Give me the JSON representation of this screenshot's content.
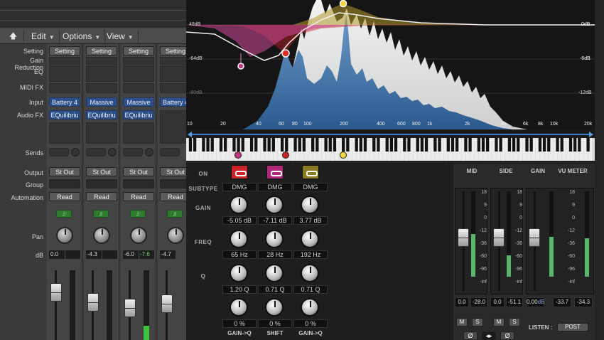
{
  "menu": {
    "edit": "Edit",
    "options": "Options",
    "view": "View"
  },
  "rows": {
    "setting": "Setting",
    "gain_reduction": "Gain Reduction",
    "eq": "EQ",
    "midi_fx": "MIDI FX",
    "input": "Input",
    "audio_fx": "Audio FX",
    "sends": "Sends",
    "output": "Output",
    "group": "Group",
    "automation": "Automation",
    "pan": "Pan",
    "db": "dB"
  },
  "channels": [
    {
      "setting": "Setting",
      "input": "Battery 4",
      "fx": "EQuilibriu",
      "output": "St Out",
      "auto": "Read",
      "db": "0.0",
      "peak": ""
    },
    {
      "setting": "Setting",
      "input": "Massive",
      "fx": "EQuilibriu",
      "output": "St Out",
      "auto": "Read",
      "db": "-4.3",
      "peak": ""
    },
    {
      "setting": "Setting",
      "input": "Massive",
      "fx": "EQuilibriu",
      "output": "St Out",
      "auto": "Read",
      "db": "-6.0",
      "peak": "-7.6"
    },
    {
      "setting": "Setting",
      "input": "Battery 4",
      "fx": "",
      "output": "St Out",
      "auto": "Read",
      "db": "-4.7",
      "peak": ""
    }
  ],
  "eq_graph": {
    "db_left": [
      "48dB",
      "-64dB",
      "-80dB"
    ],
    "db_right": [
      "0dB",
      "-6dB",
      "-12dB"
    ],
    "freq_labels": [
      "10",
      "20",
      "40",
      "60",
      "80",
      "100",
      "200",
      "400",
      "600",
      "800",
      "1k",
      "2k",
      "4k",
      "6k",
      "8k",
      "10k",
      "20k"
    ]
  },
  "band_rows": {
    "on": "ON",
    "subtype": "SUBTYPE",
    "gain": "GAIN",
    "freq": "FREQ",
    "q": "Q"
  },
  "bands": [
    {
      "color": "#c8242a",
      "subtype": "DMG",
      "gain": "-5.05 dB",
      "freq": "65 Hz",
      "q": "1.20 Q",
      "extra": "0 %",
      "label": "GAIN->Q"
    },
    {
      "color": "#c0347e",
      "subtype": "DMG",
      "gain": "-7.11 dB",
      "freq": "28 Hz",
      "q": "0.71 Q",
      "extra": "0 %",
      "label": "SHIFT"
    },
    {
      "color": "#9a8a2a",
      "subtype": "DMG",
      "gain": "3.77 dB",
      "freq": "192 Hz",
      "q": "0.71 Q",
      "extra": "0 %",
      "label": "GAIN->Q"
    }
  ],
  "ms": {
    "mid": "MID",
    "side": "SIDE",
    "gain": "GAIN",
    "vu": "VU METER",
    "scale": [
      "18",
      "9",
      "0",
      "-12",
      "-36",
      "-60",
      "-96",
      "-inf"
    ],
    "vu_scale": [
      "18",
      "9",
      "0",
      "-12",
      "-36",
      "-60",
      "-96",
      "-inf"
    ],
    "mid_vals": [
      "0.0",
      "-28.0"
    ],
    "side_vals": [
      "0.0",
      "-51.1"
    ],
    "gain_val": "0.00",
    "gain_unit": "dB",
    "vu_vals": [
      "-33.7",
      "-34.3"
    ],
    "listen": "LISTEN :",
    "post": "POST",
    "m": "M",
    "s": "S",
    "phase": "Ø",
    "link": "◂▸"
  },
  "icons": {
    "up": "up-arrow-icon"
  }
}
